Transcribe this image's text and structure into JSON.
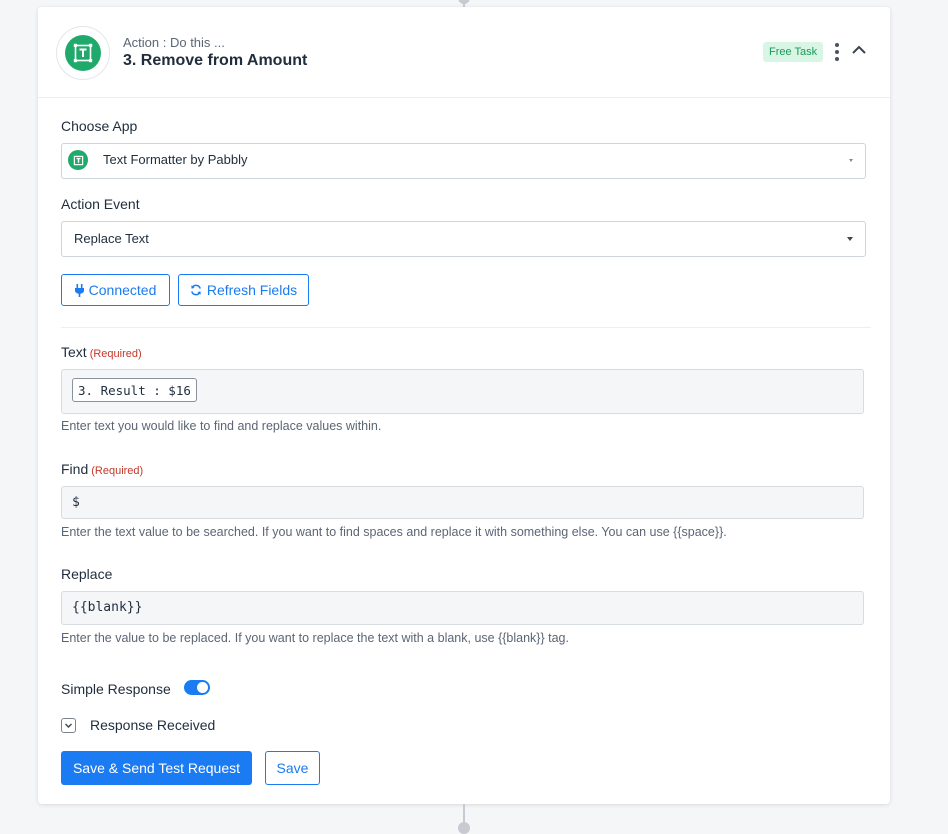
{
  "header": {
    "subtitle": "Action : Do this ...",
    "title": "3. Remove from Amount",
    "badge": "Free Task"
  },
  "choose_app": {
    "label": "Choose App",
    "value": "Text Formatter by Pabbly"
  },
  "action_event": {
    "label": "Action Event",
    "value": "Replace Text"
  },
  "buttons": {
    "connected": "Connected",
    "refresh": "Refresh Fields",
    "save_send": "Save & Send Test Request",
    "save": "Save"
  },
  "fields": {
    "text": {
      "label": "Text",
      "required": "(Required)",
      "token": "3. Result : $16",
      "help": "Enter text you would like to find and replace values within."
    },
    "find": {
      "label": "Find",
      "required": "(Required)",
      "value": "$",
      "help": "Enter the text value to be searched. If you want to find spaces and replace it with something else. You can use {{space}}."
    },
    "replace": {
      "label": "Replace",
      "value": "{{blank}}",
      "help": "Enter the value to be replaced. If you want to replace the text with a blank, use {{blank}} tag."
    }
  },
  "simple_response": {
    "label": "Simple Response",
    "enabled": true
  },
  "response_received": {
    "label": "Response Received"
  },
  "colors": {
    "primary": "#1a7bf2",
    "brand_green": "#1faa6b",
    "badge_bg": "#d9f5e5",
    "required_red": "#c0392b"
  }
}
